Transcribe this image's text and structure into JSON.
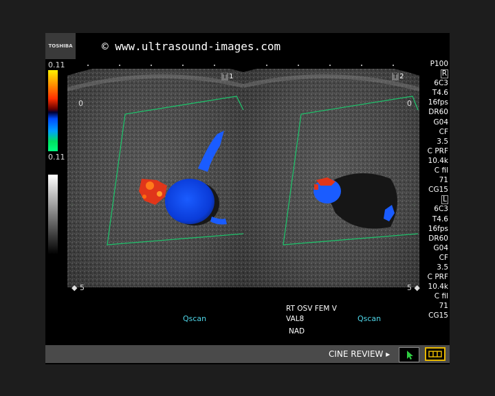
{
  "header": {
    "logo_text": "TOSHIBA",
    "copyright": "© www.ultrasound-images.com"
  },
  "scale": {
    "top_value": "0.11",
    "bottom_value": "0.11"
  },
  "left_panel": {
    "frame_label": "1",
    "depth_top": "0",
    "depth_bottom": "5",
    "mode_label": "Qscan"
  },
  "right_panel": {
    "frame_label": "2",
    "depth_top": "0",
    "depth_bottom": "5",
    "mode_label": "Qscan"
  },
  "params": {
    "preset": "P100",
    "side_right": "R",
    "block_right": [
      "6C3",
      "T4.6",
      "16fps",
      "DR60",
      "G04",
      "CF",
      "3.5",
      "C PRF",
      "10.4k",
      "C fil",
      "71",
      "CG15"
    ],
    "side_left": "L",
    "block_left": [
      "6C3",
      "T4.6",
      "16fps",
      "DR60",
      "G04",
      "CF",
      "3.5",
      "C PRF",
      "10.4k",
      "C fil",
      "71",
      "CG15"
    ]
  },
  "annotation": {
    "line1": "RT OSV FEM V",
    "line2": "VAL8",
    "line3": "NAD"
  },
  "footer": {
    "cine_label": "CINE REVIEW ▸"
  }
}
